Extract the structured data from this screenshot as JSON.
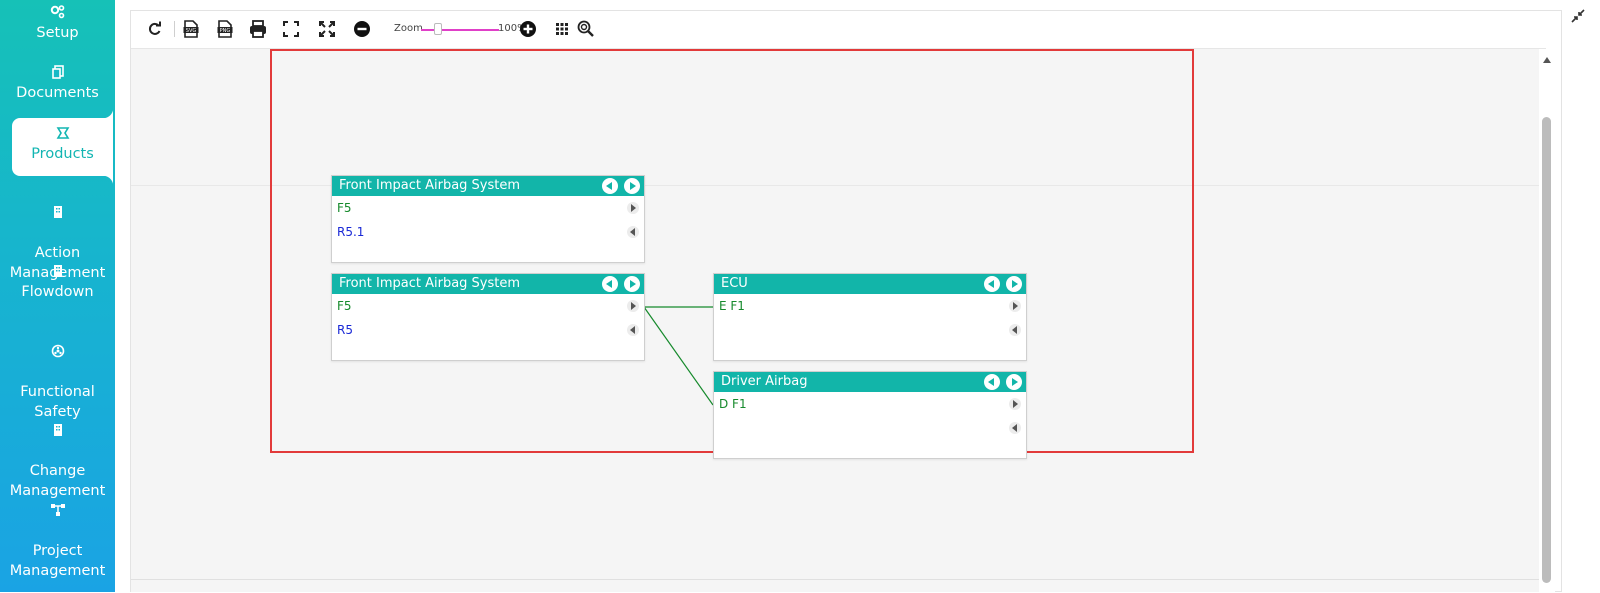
{
  "sidebar": {
    "items": [
      {
        "label": "Setup",
        "icon": "gears-icon"
      },
      {
        "label": "Documents",
        "icon": "documents-icon"
      },
      {
        "label": "Products",
        "icon": "products-icon",
        "active": true
      },
      {
        "label": "Action\nManagement",
        "icon": "building-icon"
      },
      {
        "label": "Flowdown",
        "icon": "building-icon"
      },
      {
        "label": "Functional\nSafety",
        "icon": "hazard-icon"
      },
      {
        "label": "Change\nManagement",
        "icon": "building-icon"
      },
      {
        "label": "Project\nManagement",
        "icon": "hierarchy-icon"
      }
    ]
  },
  "toolbar": {
    "zoom_label": "Zoom",
    "zoom_value": "100%",
    "zoom_level": 1.0
  },
  "diagram": {
    "nodes": [
      {
        "title": "Front Impact Airbag System",
        "rows": [
          {
            "text": "F5",
            "color": "green"
          },
          {
            "text": "R5.1",
            "color": "blue"
          }
        ]
      },
      {
        "title": "Front Impact Airbag System",
        "rows": [
          {
            "text": "F5",
            "color": "green"
          },
          {
            "text": "R5",
            "color": "blue"
          }
        ]
      },
      {
        "title": "ECU",
        "rows": [
          {
            "text": "E F1",
            "color": "green"
          }
        ]
      },
      {
        "title": "Driver Airbag",
        "rows": [
          {
            "text": "D F1",
            "color": "green"
          }
        ]
      }
    ],
    "colors": {
      "header": "#12b5a9",
      "link": "#168a2c",
      "selection": "#e23a3a"
    }
  }
}
